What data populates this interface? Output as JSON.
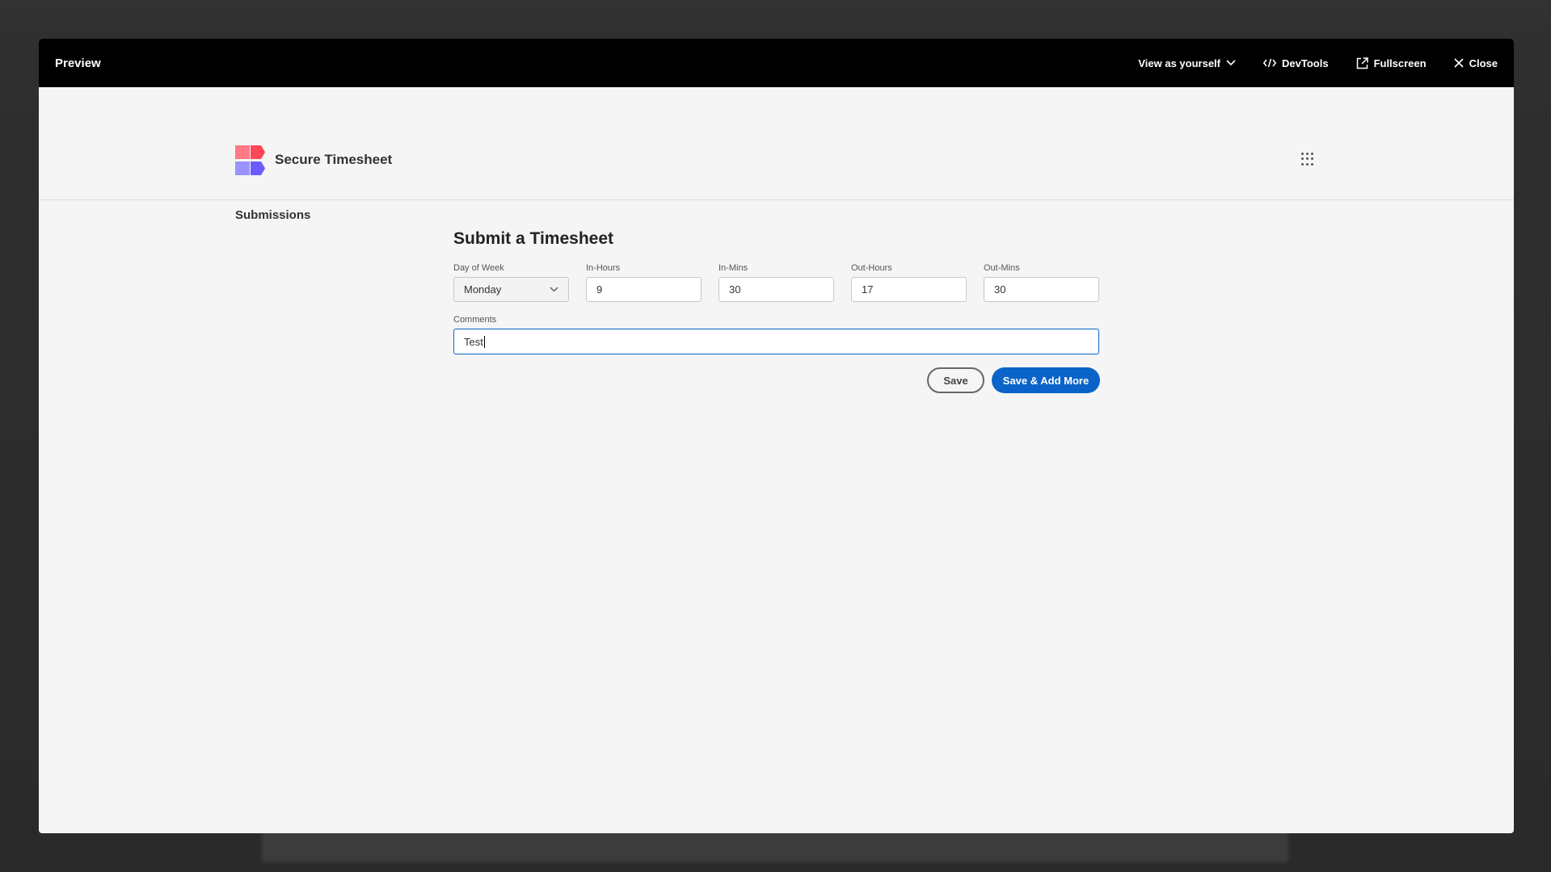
{
  "preview_bar": {
    "title": "Preview",
    "view_as": "View as yourself",
    "devtools": "DevTools",
    "fullscreen": "Fullscreen",
    "close": "Close"
  },
  "app": {
    "title": "Secure Timesheet",
    "nav": [
      "Submissions"
    ]
  },
  "form": {
    "title": "Submit a Timesheet",
    "fields": [
      {
        "label": "Day of Week",
        "value": "Monday",
        "type": "select"
      },
      {
        "label": "In-Hours",
        "value": "9"
      },
      {
        "label": "In-Mins",
        "value": "30"
      },
      {
        "label": "Out-Hours",
        "value": "17"
      },
      {
        "label": "Out-Mins",
        "value": "30"
      }
    ],
    "comments": {
      "label": "Comments",
      "value": "Test"
    },
    "save_label": "Save",
    "save_add_label": "Save & Add More"
  },
  "colors": {
    "accent": "#0a63c9",
    "logo_red": "#ff4757",
    "logo_purple": "#6a5cff"
  }
}
